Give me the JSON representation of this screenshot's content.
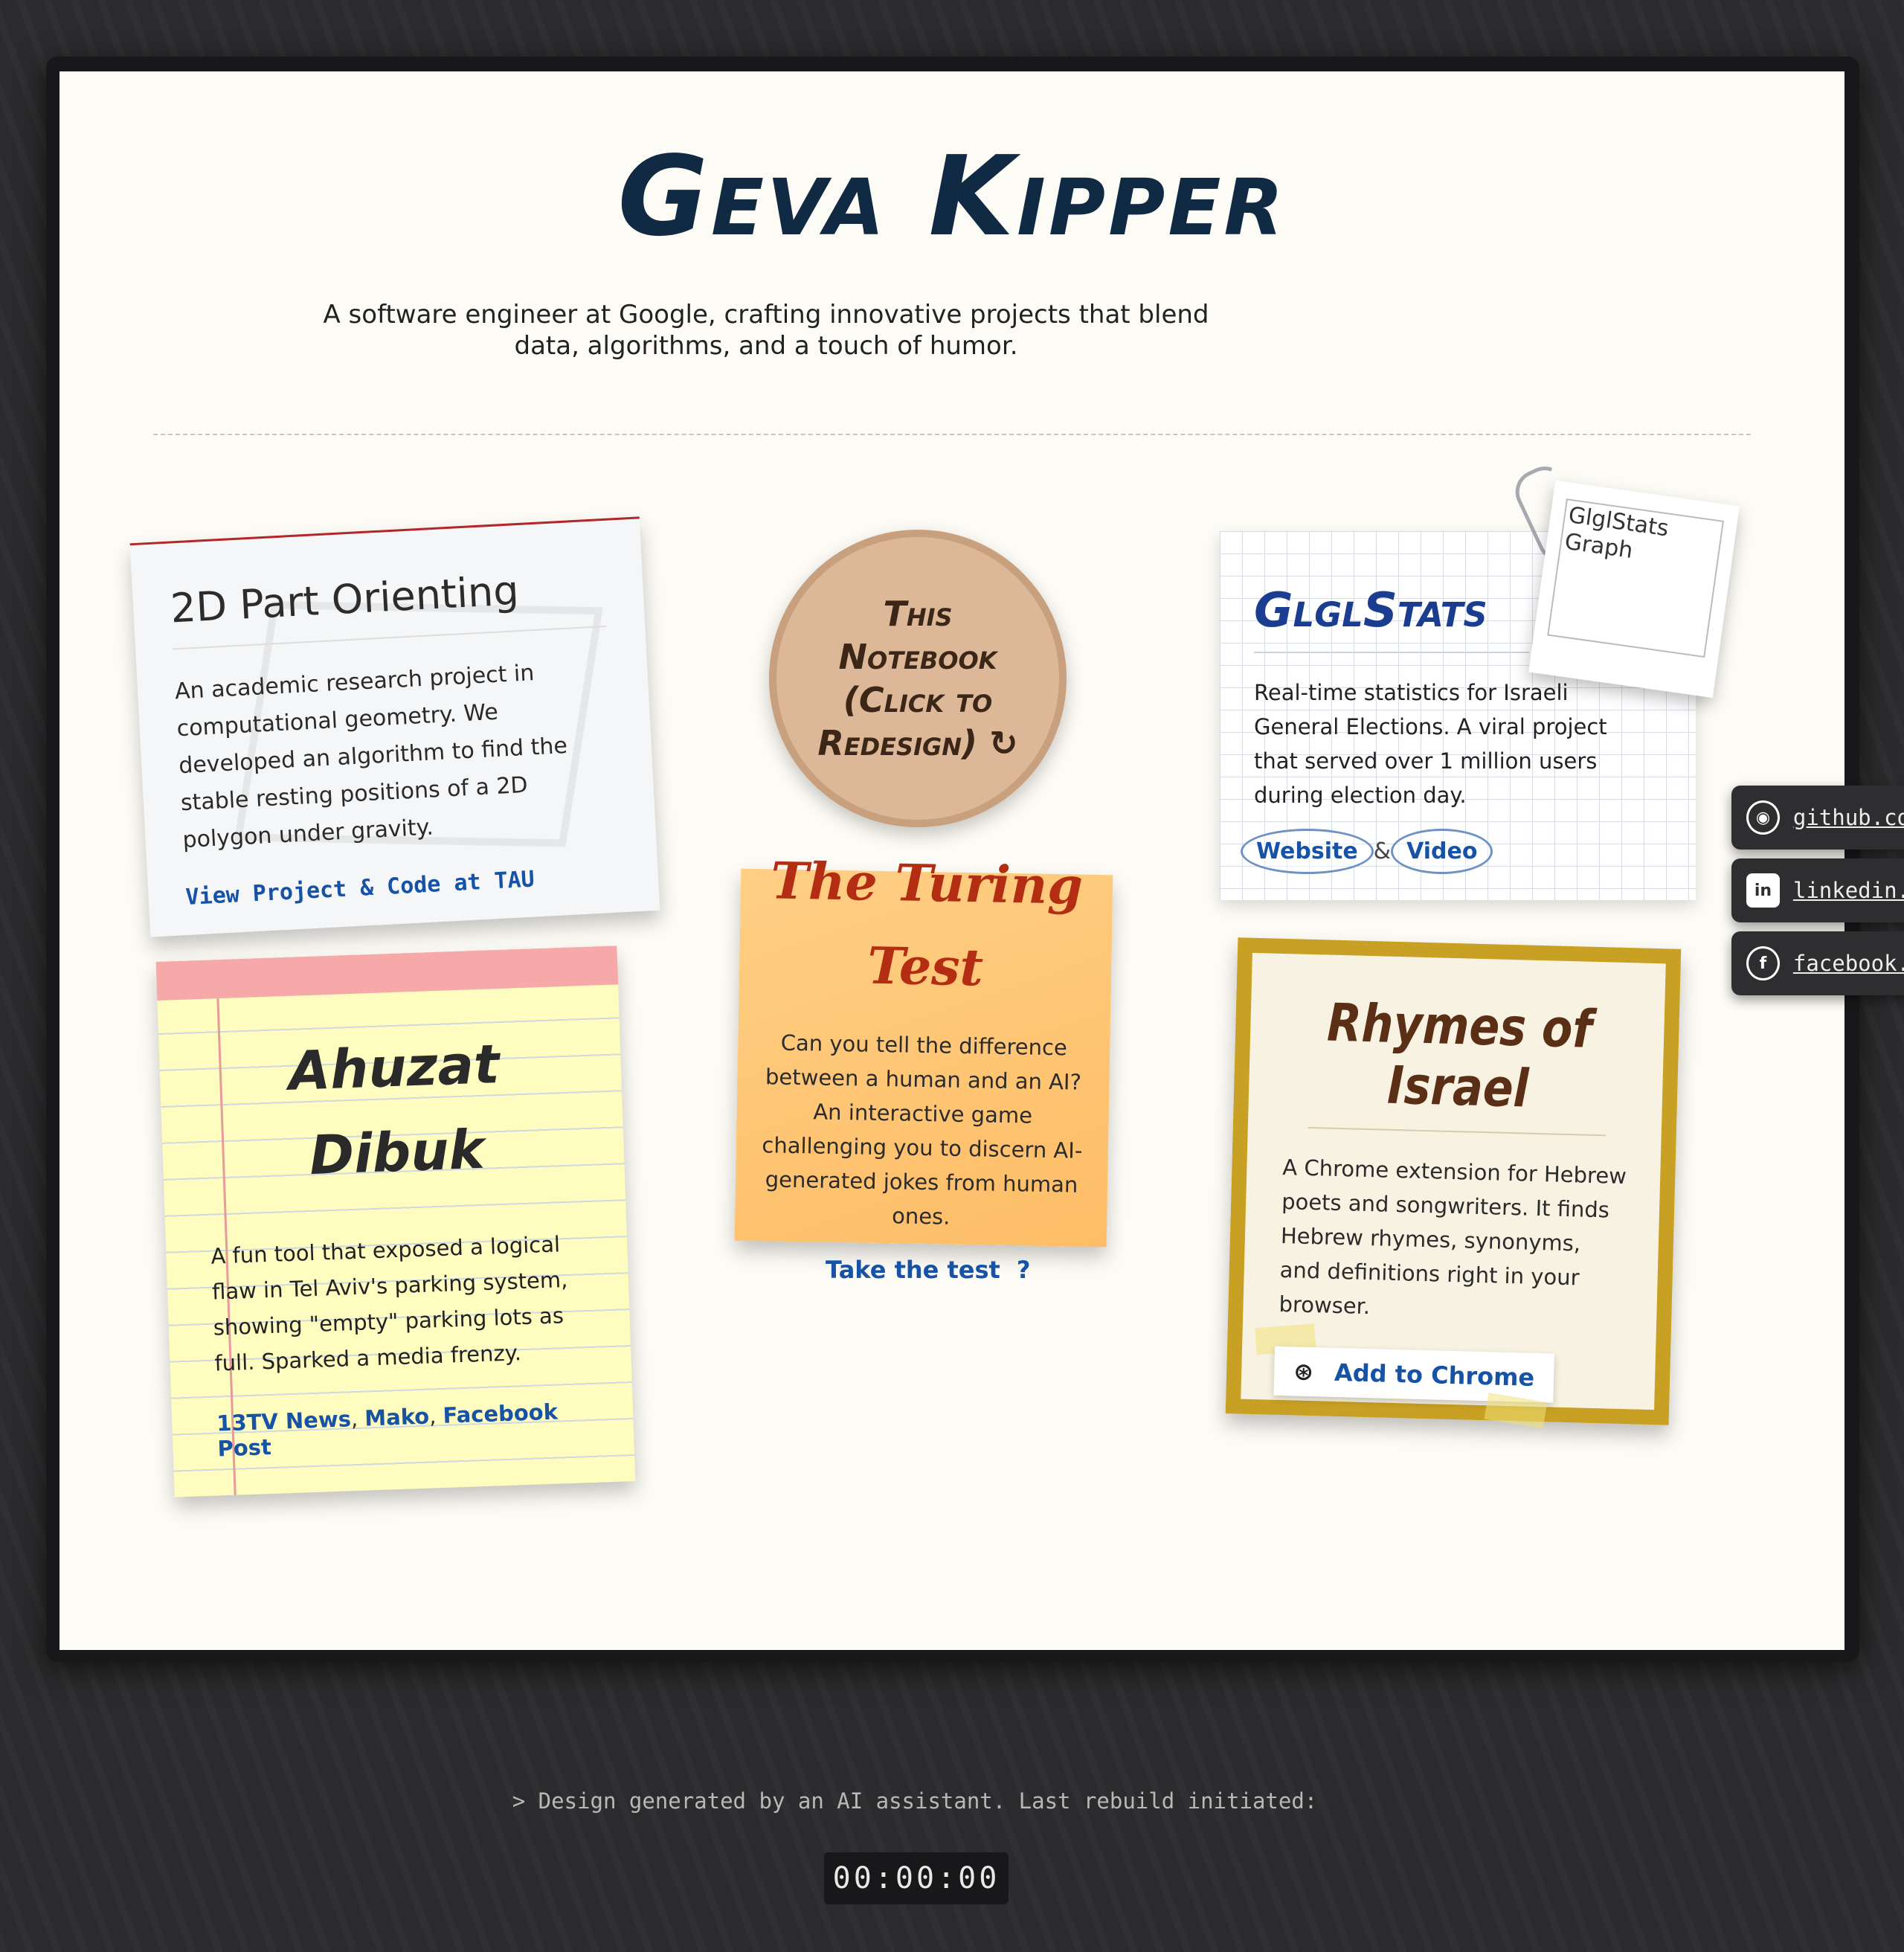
{
  "header": {
    "title": "Geva Kipper",
    "tagline": "A software engineer at Google, crafting innovative projects that blend data, algorithms, and a touch of humor."
  },
  "redesign_button": {
    "label": "This Notebook (Click to Redesign) ↻"
  },
  "projects": {
    "part_orienting": {
      "title": "2D Part Orienting",
      "description": "An academic research project in computational geometry. We developed an algorithm to find the stable resting positions of a 2D polygon under gravity.",
      "link": "View Project & Code at TAU"
    },
    "ahuzat_dibuk": {
      "title": "Ahuzat Dibuk",
      "description": "A fun tool that exposed a logical flaw in Tel Aviv's parking system, showing \"empty\" parking lots as full. Sparked a media frenzy.",
      "links": [
        "13TV News",
        "Mako",
        "Facebook Post"
      ],
      "separator": ","
    },
    "turing_test": {
      "title": "The Turing Test",
      "description": "Can you tell the difference between a human and an AI? An interactive game challenging you to discern AI-generated jokes from human ones.",
      "link": "Take the test",
      "link_suffix": "?"
    },
    "glglstats": {
      "title": "GlglStats",
      "description": "Real-time statistics for Israeli General Elections. A viral project that served over 1 million users during election day.",
      "links": [
        "Website",
        "Video"
      ],
      "separator": "&",
      "image_alt": "GlglStats Graph"
    },
    "rhymes": {
      "title": "Rhymes of Israel",
      "description": "A Chrome extension for Hebrew poets and songwriters. It finds Hebrew rhymes, synonyms, and definitions right in your browser.",
      "button": "Add to Chrome"
    }
  },
  "social": [
    {
      "icon": "github-icon",
      "label": "github.co"
    },
    {
      "icon": "linkedin-icon",
      "label": "linkedin."
    },
    {
      "icon": "facebook-icon",
      "label": "facebook."
    }
  ],
  "footer": {
    "note": "> Design generated by an AI assistant. Last rebuild initiated:",
    "timer": "00:00:00"
  },
  "colors": {
    "page_background": "#2b2b2d",
    "paper": "#fdfbf5",
    "title": "#102a43",
    "link": "#1653a6",
    "turing_title": "#b32d12",
    "rhymes_frame": "#c8a023"
  }
}
